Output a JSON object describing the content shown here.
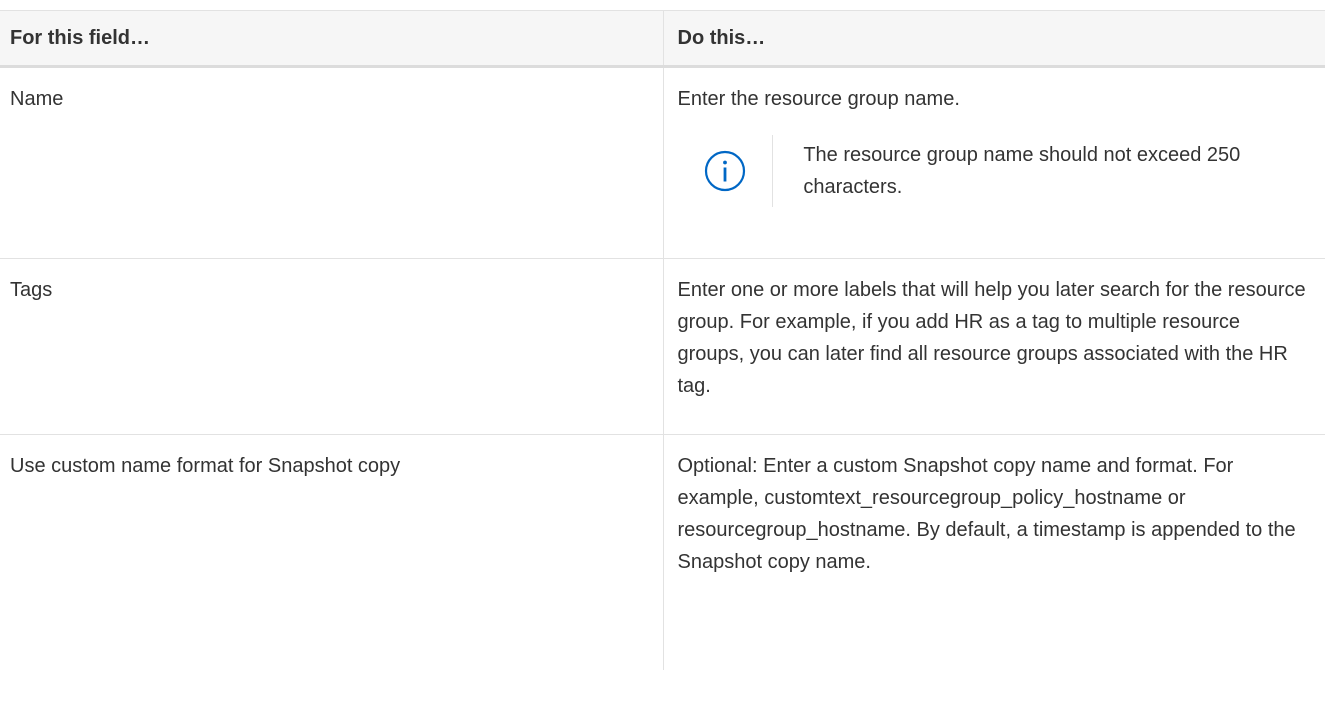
{
  "table": {
    "headers": [
      "For this field…",
      "Do this…"
    ],
    "rows": [
      {
        "field": "Name",
        "action": "Enter the resource group name.",
        "note": {
          "icon": "info-icon",
          "text": "The resource group name should not exceed 250 characters."
        }
      },
      {
        "field": "Tags",
        "action": "Enter one or more labels that will help you later search for the resource group. For example, if you add HR as a tag to multiple resource groups, you can later find all resource groups associated with the HR tag."
      },
      {
        "field": "Use custom name format for Snapshot copy",
        "action": "Optional: Enter a custom Snapshot copy name and format. For example, customtext_resourcegroup_policy_hostname or resourcegroup_hostname. By default, a timestamp is appended to the Snapshot copy name."
      }
    ]
  },
  "colors": {
    "text": "#333333",
    "header_bg": "#f6f6f6",
    "border": "#e2e2e2",
    "icon": "#0067c5"
  }
}
